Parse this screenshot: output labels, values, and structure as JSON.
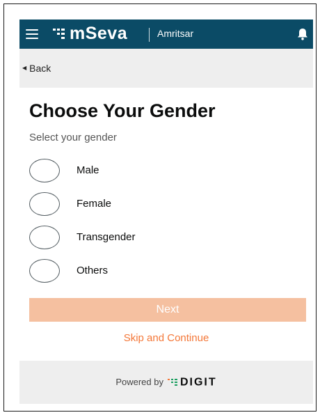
{
  "header": {
    "brand": "mSeva",
    "city": "Amritsar",
    "colors": {
      "bar": "#0b4b66",
      "text": "#ffffff"
    },
    "icons": [
      "hamburger-menu-icon",
      "mseva-logo-icon",
      "notification-bell-icon"
    ]
  },
  "back": {
    "label": "Back",
    "icon": "chevron-left-icon"
  },
  "main": {
    "title": "Choose Your Gender",
    "subtitle": "Select your gender",
    "options": [
      {
        "label": "Male"
      },
      {
        "label": "Female"
      },
      {
        "label": "Transgender"
      },
      {
        "label": "Others"
      }
    ],
    "next_label": "Next",
    "skip_label": "Skip and Continue",
    "colors": {
      "accent": "#f47738",
      "button_disabled": "#f5c0a0"
    }
  },
  "footer": {
    "powered_by": "Powered by",
    "brand": "DIGIT",
    "icon": "digit-logo-icon"
  }
}
